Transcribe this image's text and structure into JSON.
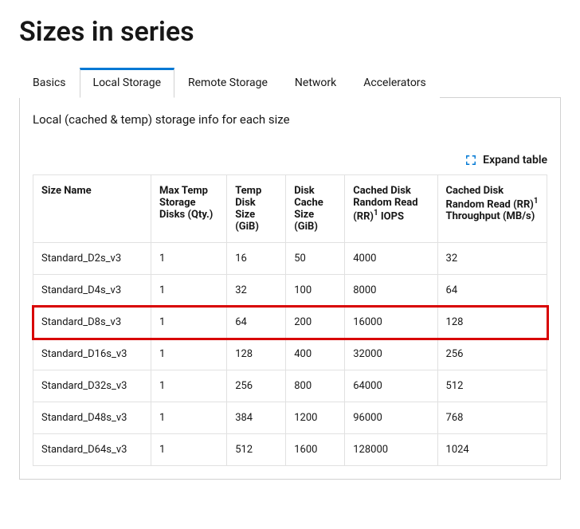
{
  "page_title": "Sizes in series",
  "tabs": [
    {
      "label": "Basics",
      "active": false
    },
    {
      "label": "Local Storage",
      "active": true
    },
    {
      "label": "Remote Storage",
      "active": false
    },
    {
      "label": "Network",
      "active": false
    },
    {
      "label": "Accelerators",
      "active": false
    }
  ],
  "panel": {
    "description": "Local (cached & temp) storage info for each size",
    "expand_label": "Expand table"
  },
  "table": {
    "headers": {
      "size_name": "Size Name",
      "max_temp_disks": "Max Temp Storage Disks (Qty.)",
      "temp_disk_size": "Temp Disk Size (GiB)",
      "disk_cache_size": "Disk Cache Size (GiB)",
      "cached_rr_iops_pre": "Cached Disk Random Read (RR)",
      "cached_rr_iops_sup": "1",
      "cached_rr_iops_post": " IOPS",
      "cached_rr_tp_pre": "Cached Disk Random Read (RR)",
      "cached_rr_tp_sup": "1",
      "cached_rr_tp_post": " Throughput (MB/s)"
    },
    "rows": [
      {
        "name": "Standard_D2s_v3",
        "qty": "1",
        "tmp": "16",
        "cache": "50",
        "iops": "4000",
        "tp": "32",
        "hl": false
      },
      {
        "name": "Standard_D4s_v3",
        "qty": "1",
        "tmp": "32",
        "cache": "100",
        "iops": "8000",
        "tp": "64",
        "hl": false
      },
      {
        "name": "Standard_D8s_v3",
        "qty": "1",
        "tmp": "64",
        "cache": "200",
        "iops": "16000",
        "tp": "128",
        "hl": true
      },
      {
        "name": "Standard_D16s_v3",
        "qty": "1",
        "tmp": "128",
        "cache": "400",
        "iops": "32000",
        "tp": "256",
        "hl": false
      },
      {
        "name": "Standard_D32s_v3",
        "qty": "1",
        "tmp": "256",
        "cache": "800",
        "iops": "64000",
        "tp": "512",
        "hl": false
      },
      {
        "name": "Standard_D48s_v3",
        "qty": "1",
        "tmp": "384",
        "cache": "1200",
        "iops": "96000",
        "tp": "768",
        "hl": false
      },
      {
        "name": "Standard_D64s_v3",
        "qty": "1",
        "tmp": "512",
        "cache": "1600",
        "iops": "128000",
        "tp": "1024",
        "hl": false
      }
    ]
  }
}
